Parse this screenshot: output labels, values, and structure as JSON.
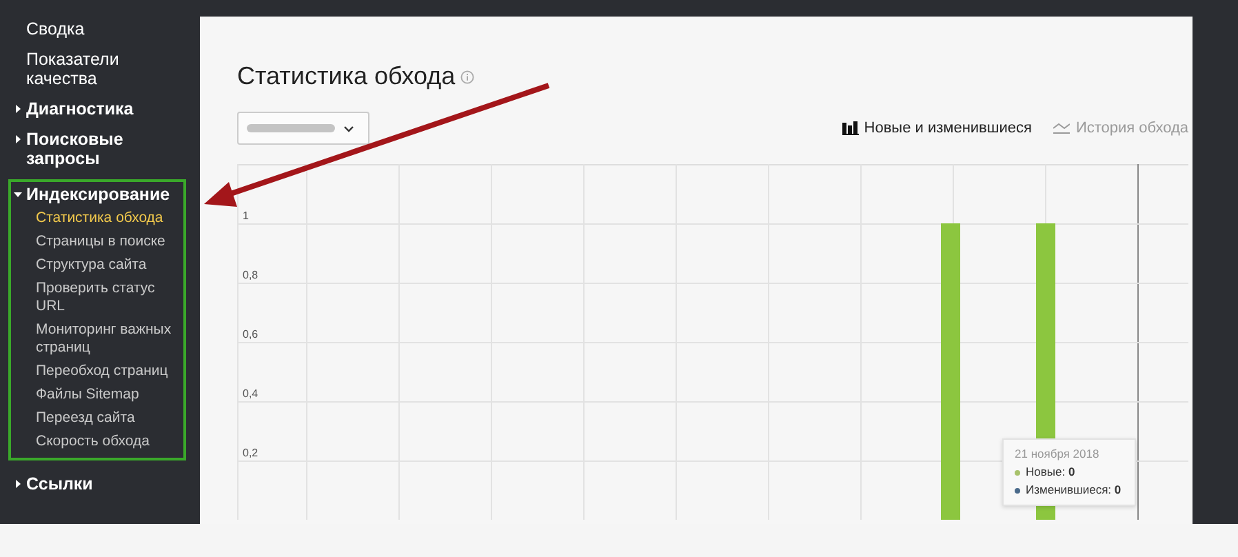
{
  "sidebar": {
    "items": [
      {
        "label": "Сводка",
        "kind": "link",
        "selected": false
      },
      {
        "label": "Показатели качества",
        "kind": "link",
        "selected": false
      },
      {
        "label": "Диагностика",
        "kind": "group",
        "expanded": false
      },
      {
        "label": "Поисковые запросы",
        "kind": "group",
        "expanded": false
      },
      {
        "label": "Индексирование",
        "kind": "group",
        "expanded": true,
        "highlighted": true,
        "children": [
          {
            "label": "Статистика обхода",
            "selected": true
          },
          {
            "label": "Страницы в поиске",
            "selected": false
          },
          {
            "label": "Структура сайта",
            "selected": false
          },
          {
            "label": "Проверить статус URL",
            "selected": false
          },
          {
            "label": "Мониторинг важных страниц",
            "selected": false
          },
          {
            "label": "Переобход страниц",
            "selected": false
          },
          {
            "label": "Файлы Sitemap",
            "selected": false
          },
          {
            "label": "Переезд сайта",
            "selected": false
          },
          {
            "label": "Скорость обхода",
            "selected": false
          }
        ]
      },
      {
        "label": "Ссылки",
        "kind": "group",
        "expanded": false
      }
    ]
  },
  "page": {
    "title": "Статистика обхода",
    "view_toggles": [
      {
        "label": "Новые и изменившиеся",
        "selected": true,
        "kind": "bars"
      },
      {
        "label": "История обхода",
        "selected": false,
        "kind": "line"
      }
    ],
    "chart_data": {
      "type": "bar",
      "grid": true,
      "ylim": [
        0,
        1.2
      ],
      "yticks": [
        {
          "value": 0.2,
          "label": "0,2"
        },
        {
          "value": 0.4,
          "label": "0,4"
        },
        {
          "value": 0.6,
          "label": "0,6"
        },
        {
          "value": 0.8,
          "label": "0,8"
        },
        {
          "value": 1,
          "label": "1"
        }
      ],
      "series": [
        {
          "color": "#8cc63f",
          "values": [
            0,
            0,
            0,
            0,
            0,
            0,
            0,
            1,
            1,
            0
          ]
        }
      ]
    },
    "tooltip": {
      "date": "21 ноября 2018",
      "rows": [
        {
          "label": "Новые:",
          "value": "0",
          "color": "#a8c26b"
        },
        {
          "label": "Изменившиеся:",
          "value": "0",
          "color": "#4a6a8a"
        }
      ]
    }
  }
}
